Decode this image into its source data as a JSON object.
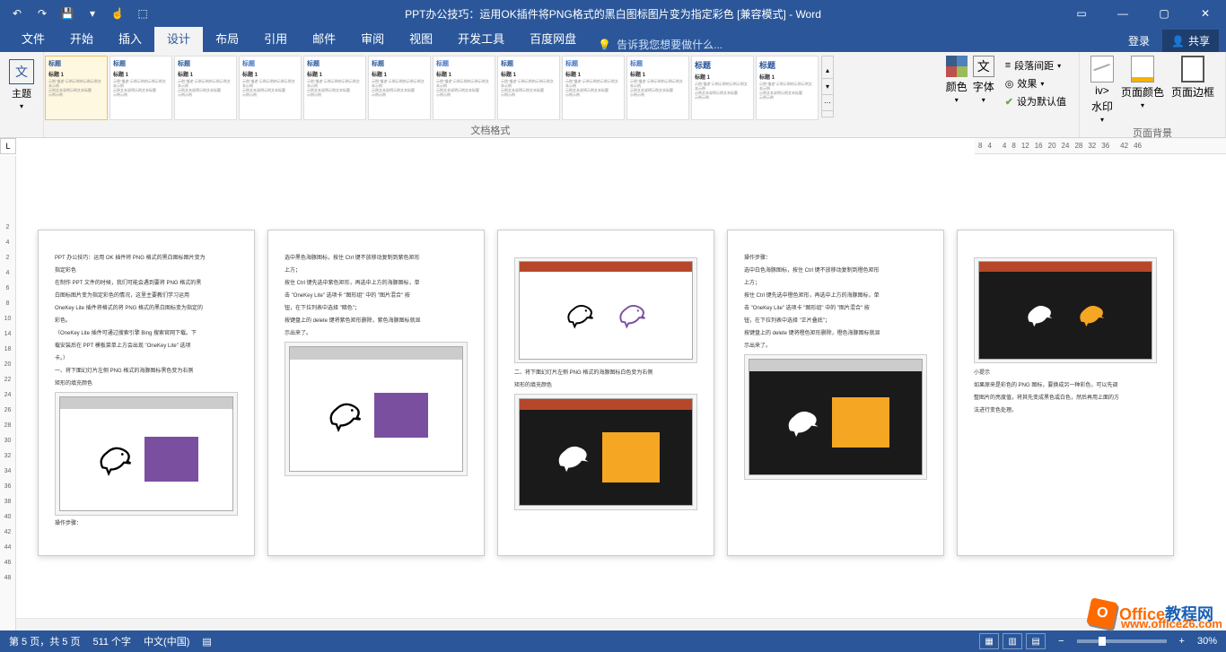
{
  "title": "PPT办公技巧：运用OK插件将PNG格式的黑白图标图片变为指定彩色 [兼容模式] - Word",
  "qat": {
    "undo": "↶",
    "redo": "↷",
    "save": "💾",
    "save_dd": "▾",
    "touch": "☝",
    "mode": "⬚"
  },
  "win": {
    "ribbon_opts": "▭",
    "min": "—",
    "max": "▢",
    "close": "✕"
  },
  "tabs": {
    "file": "文件",
    "home": "开始",
    "insert": "插入",
    "design": "设计",
    "layout": "布局",
    "references": "引用",
    "mail": "邮件",
    "review": "审阅",
    "view": "视图",
    "developer": "开发工具",
    "baidu": "百度网盘"
  },
  "tellme": {
    "icon": "💡",
    "placeholder": "告诉我您想要做什么..."
  },
  "login": "登录",
  "share": "共享",
  "ribbon": {
    "themes": "主题",
    "style_title": "标题",
    "style_subtitle": "标题 1",
    "format_group": "文档格式",
    "colors": "颜色",
    "fonts": "字体",
    "para_spacing": "段落间距",
    "effects": "效果",
    "set_default": "设为默认值",
    "watermark": "水印",
    "page_color": "页面颜色",
    "page_border": "页面边框",
    "page_bg_group": "页面背景"
  },
  "h_ruler": [
    "8",
    "4",
    "",
    "4",
    "8",
    "12",
    "16",
    "20",
    "24",
    "28",
    "32",
    "36",
    "",
    "42",
    "46"
  ],
  "v_ruler": [
    "2",
    "4",
    "",
    "2",
    "4",
    "6",
    "8",
    "10",
    "14",
    "18",
    "20",
    "22",
    "24",
    "26",
    "28",
    "30",
    "32",
    "34",
    "36",
    "38",
    "40",
    "42",
    "44",
    "46",
    "",
    "48"
  ],
  "pages": {
    "p1": {
      "l1": "PPT 办公技巧：运用 OK 插件将 PNG 格式的黑白图标图片变为",
      "l2": "指定彩色",
      "l3": "在制作 PPT 文件的时候，我们可能会遇到要将 PNG 格式的黑",
      "l4": "白图标图片变为指定彩色的情况，这里主要教们学习运用",
      "l5": "OneKey Lite 插件将格式的将 PNG 格式的黑白图标变为指定的",
      "l6": "彩色。",
      "l7": "（OneKey Lite 插件可通过搜索引擎 Bing 搜索官网下载。下",
      "l8": "载安装后在 PPT 模板菜单上方会出现 \"OneKey Lite\" 选项",
      "l9": "卡。）",
      "l10": "一、将下面幻灯片左侧 PNG 格式的海豚图标黑色变为右侧",
      "l11": "矩形的填充颜色",
      "after": "操作步骤："
    },
    "p2": {
      "l1": "选中黑色海豚图标，按住 Ctrl 键不放移动复制到紫色矩形",
      "l2": "上方；",
      "l3": "按住 Ctrl 键先选中紫色矩形，再选中上方的海豚图标，单",
      "l4": "击 \"OneKey Lite\" 选项卡 \"图形组\" 中的 \"图片混合\" 按",
      "l5": "钮，在下拉列表中选择 \"暗色\"；",
      "l6": "按键盘上的 delete 键将紫色矩形删除，紫色海豚图标就显",
      "l7": "示出来了。"
    },
    "p3": {
      "l1": "二、将下面幻灯片左侧 PNG 格式的海豚图标白色变为右侧",
      "l2": "矩形的填充颜色"
    },
    "p4": {
      "l1": "操作步骤：",
      "l2": "选中白色海豚图标，按住 Ctrl 键不放移动复制到橙色矩形",
      "l3": "上方；",
      "l4": "按住 Ctrl 键先选中橙色矩形，再选中上方的海豚图标，单",
      "l5": "击 \"OneKey Lite\" 选项卡 \"图形组\" 中的 \"图片混合\" 按",
      "l6": "钮，在下拉列表中选择 \"正片叠底\"；",
      "l7": "按键盘上的 delete 键将橙色矩形删除，橙色海豚图标就显",
      "l8": "示出来了。"
    },
    "p5": {
      "l1": "小提示",
      "l2": "如果原来是彩色的 PNG 图标，要换成另一种彩色，可以先调",
      "l3": "整图片的亮度值，将其先变成黑色或白色，然后再用上面的方",
      "l4": "法进行变色处理。"
    }
  },
  "status": {
    "page": "第 5 页，共 5 页",
    "words": "511 个字",
    "lang": "中文(中国)",
    "zoom_minus": "−",
    "zoom_plus": "+",
    "zoom": "30%"
  },
  "logo": {
    "brand1": "Office",
    "brand2": "教程网",
    "url": "www.office26.com"
  },
  "ruler_L": "L"
}
